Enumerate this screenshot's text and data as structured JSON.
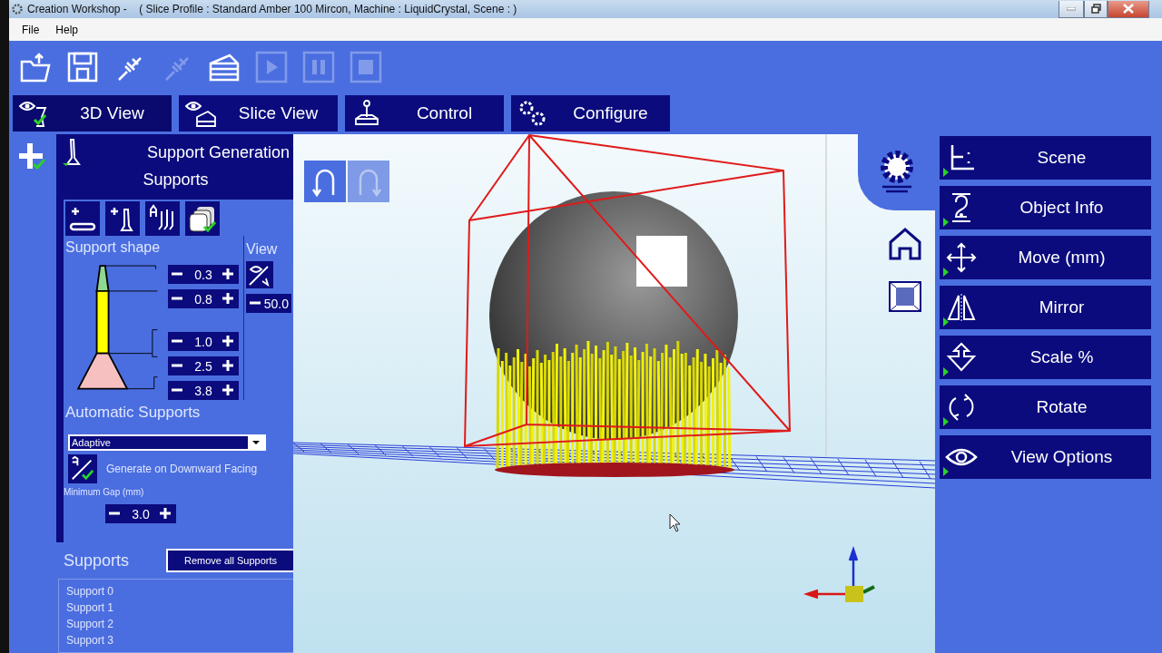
{
  "window": {
    "title": "Creation Workshop -    ( Slice Profile : Standard Amber 100 Mircon, Machine : LiquidCrystal, Scene : )"
  },
  "menu": [
    "File",
    "Help"
  ],
  "toolbar": [
    {
      "kind": "open",
      "disabled": false
    },
    {
      "kind": "save",
      "disabled": false
    },
    {
      "kind": "connect",
      "disabled": false
    },
    {
      "kind": "disconnect",
      "disabled": true
    },
    {
      "kind": "slice",
      "disabled": false
    },
    {
      "kind": "play",
      "disabled": true
    },
    {
      "kind": "pause",
      "disabled": true
    },
    {
      "kind": "stop",
      "disabled": true
    }
  ],
  "tabs": [
    {
      "label": "3D View",
      "kind": "view3d",
      "selected": true
    },
    {
      "label": "Slice View",
      "kind": "slice",
      "selected": false
    },
    {
      "label": "Control",
      "kind": "control",
      "selected": false
    },
    {
      "label": "Configure",
      "kind": "configure",
      "selected": false
    }
  ],
  "support_panel": {
    "title": "Support Generation",
    "subtitle": "Supports",
    "tools": [
      {
        "kind": "add-base"
      },
      {
        "kind": "add-support"
      },
      {
        "kind": "auto-supports"
      },
      {
        "kind": "layers"
      }
    ],
    "shape_label": "Support shape",
    "shape_values": [
      "0.3",
      "0.8",
      "1.0",
      "2.5",
      "3.8"
    ],
    "view_label": "View",
    "view_value": "50.0",
    "auto_label": "Automatic Supports",
    "auto_mode": "Adaptive",
    "downward": {
      "label": "Generate on Downward Facing",
      "checked": true
    },
    "gap_label": "Minimum Gap (mm)",
    "gap_value": "3.0",
    "list_title": "Supports",
    "remove_button": "Remove all Supports",
    "items": [
      "Support 0",
      "Support 1",
      "Support 2",
      "Support 3"
    ]
  },
  "right_panel": [
    {
      "label": "Scene",
      "kind": "scene"
    },
    {
      "label": "Object Info",
      "kind": "info"
    },
    {
      "label": "Move (mm)",
      "kind": "move"
    },
    {
      "label": "Mirror",
      "kind": "mirror"
    },
    {
      "label": "Scale %",
      "kind": "scale"
    },
    {
      "label": "Rotate",
      "kind": "rotate"
    },
    {
      "label": "View Options",
      "kind": "view"
    }
  ]
}
